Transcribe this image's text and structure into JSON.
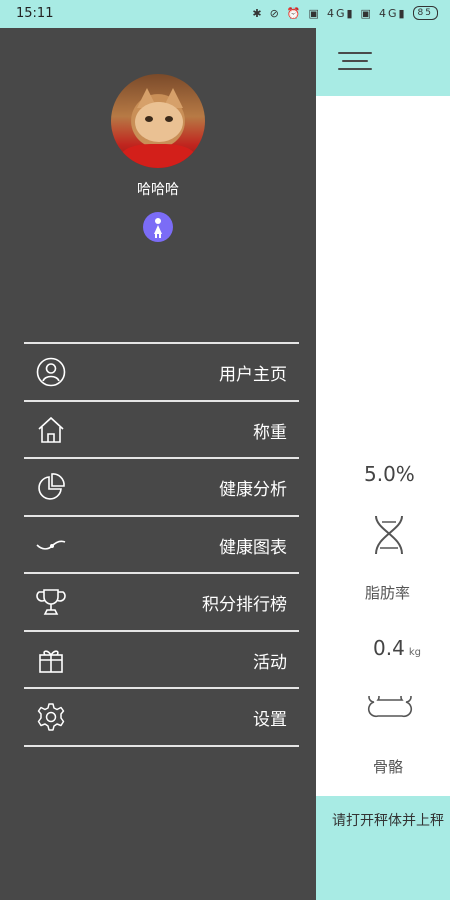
{
  "status_bar": {
    "time": "15:11",
    "icons": [
      "bluetooth-icon",
      "mute-icon",
      "alarm-icon",
      "hd-icon",
      "4g-signal-icon",
      "hd-icon",
      "4g-signal-icon"
    ],
    "network_1": "4G",
    "network_2": "4G",
    "battery": "85"
  },
  "drawer": {
    "username": "哈哈哈",
    "menu": [
      {
        "label": "用户主页",
        "icon": "user-icon"
      },
      {
        "label": "称重",
        "icon": "home-icon"
      },
      {
        "label": "健康分析",
        "icon": "pie-chart-icon"
      },
      {
        "label": "健康图表",
        "icon": "curve-chart-icon"
      },
      {
        "label": "积分排行榜",
        "icon": "trophy-icon"
      },
      {
        "label": "活动",
        "icon": "gift-icon"
      },
      {
        "label": "设置",
        "icon": "gear-icon"
      }
    ]
  },
  "main": {
    "fat_value": "5.0%",
    "fat_label": "脂肪率",
    "bone_value": "0.4",
    "bone_unit": "kg",
    "bone_label": "骨骼",
    "tip": "请打开秤体并上秤"
  },
  "colors": {
    "accent": "#a8ebe4",
    "drawer_bg": "#484848",
    "gender_badge": "#7b6cf6"
  }
}
